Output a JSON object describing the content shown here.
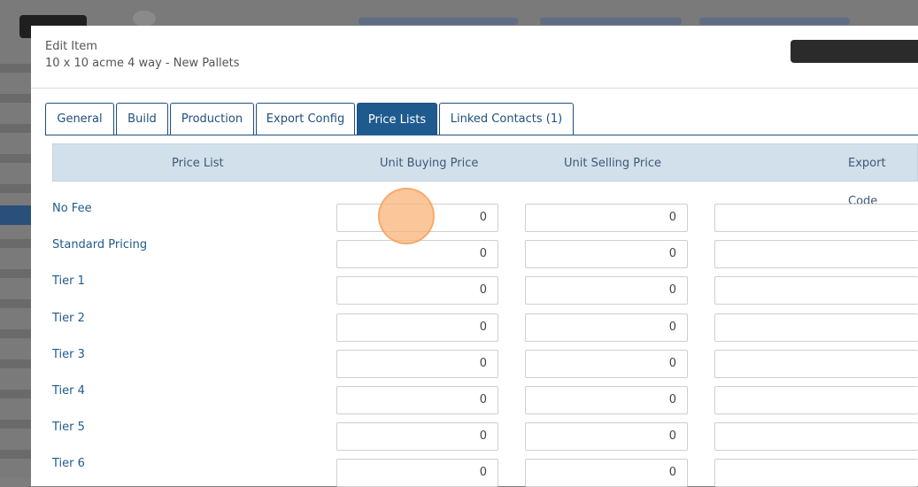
{
  "modal": {
    "title": "Edit Item",
    "subtitle": "10 x 10 acme 4 way - New Pallets"
  },
  "tabs": [
    {
      "label": "General",
      "active": false
    },
    {
      "label": "Build",
      "active": false
    },
    {
      "label": "Production",
      "active": false
    },
    {
      "label": "Export Config",
      "active": false
    },
    {
      "label": "Price Lists",
      "active": true
    },
    {
      "label": "Linked Contacts (1)",
      "active": false
    }
  ],
  "table": {
    "headers": {
      "price_list": "Price List",
      "unit_buying_price": "Unit Buying Price",
      "unit_selling_price": "Unit Selling Price",
      "export_code": "Export Code"
    },
    "rows": [
      {
        "name": "No Fee",
        "buying": "0",
        "selling": "0",
        "export_code": ""
      },
      {
        "name": "Standard Pricing",
        "buying": "0",
        "selling": "0",
        "export_code": ""
      },
      {
        "name": "Tier 1",
        "buying": "0",
        "selling": "0",
        "export_code": ""
      },
      {
        "name": "Tier 2",
        "buying": "0",
        "selling": "0",
        "export_code": ""
      },
      {
        "name": "Tier 3",
        "buying": "0",
        "selling": "0",
        "export_code": ""
      },
      {
        "name": "Tier 4",
        "buying": "0",
        "selling": "0",
        "export_code": ""
      },
      {
        "name": "Tier 5",
        "buying": "0",
        "selling": "0",
        "export_code": ""
      },
      {
        "name": "Tier 6",
        "buying": "0",
        "selling": "0",
        "export_code": ""
      }
    ]
  },
  "colors": {
    "accent": "#1f5a8f",
    "header_bg": "#d2e0eb"
  }
}
